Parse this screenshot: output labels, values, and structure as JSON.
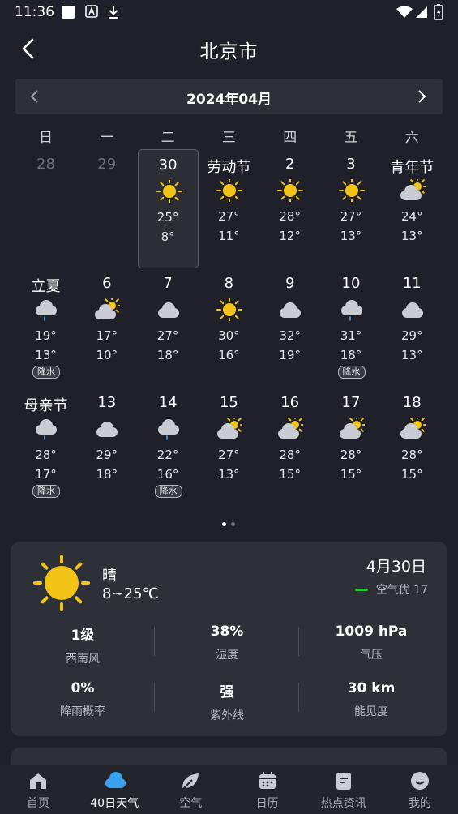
{
  "status": {
    "time": "11:36"
  },
  "header": {
    "city": "北京市"
  },
  "calendar": {
    "month": "2024年04月",
    "weekdays": [
      "日",
      "一",
      "二",
      "三",
      "四",
      "五",
      "六"
    ],
    "days": [
      {
        "label": "28",
        "dim": true
      },
      {
        "label": "29",
        "dim": true
      },
      {
        "label": "30",
        "icon": "sun-icon",
        "high": "25°",
        "low": "8°",
        "selected": true
      },
      {
        "label": "劳动节",
        "icon": "sun-icon",
        "high": "27°",
        "low": "11°"
      },
      {
        "label": "2",
        "icon": "sun-icon",
        "high": "28°",
        "low": "12°"
      },
      {
        "label": "3",
        "icon": "sun-icon",
        "high": "27°",
        "low": "13°"
      },
      {
        "label": "青年节",
        "icon": "partly-cloudy-icon",
        "high": "24°",
        "low": "13°"
      },
      {
        "label": "立夏",
        "icon": "rain-cloud-icon",
        "high": "19°",
        "low": "13°",
        "badge": "降水"
      },
      {
        "label": "6",
        "icon": "partly-cloudy-icon",
        "high": "17°",
        "low": "10°"
      },
      {
        "label": "7",
        "icon": "cloud-icon",
        "high": "27°",
        "low": "18°"
      },
      {
        "label": "8",
        "icon": "sun-icon",
        "high": "30°",
        "low": "16°"
      },
      {
        "label": "9",
        "icon": "cloud-icon",
        "high": "32°",
        "low": "19°"
      },
      {
        "label": "10",
        "icon": "rain-cloud-icon",
        "high": "31°",
        "low": "18°",
        "badge": "降水"
      },
      {
        "label": "11",
        "icon": "cloud-icon",
        "high": "29°",
        "low": "13°"
      },
      {
        "label": "母亲节",
        "icon": "rain-cloud-icon",
        "high": "28°",
        "low": "17°",
        "badge": "降水"
      },
      {
        "label": "13",
        "icon": "cloud-icon",
        "high": "29°",
        "low": "18°"
      },
      {
        "label": "14",
        "icon": "rain-cloud-icon",
        "high": "22°",
        "low": "16°",
        "badge": "降水"
      },
      {
        "label": "15",
        "icon": "partly-cloudy-icon",
        "high": "27°",
        "low": "13°"
      },
      {
        "label": "16",
        "icon": "partly-cloudy-icon",
        "high": "28°",
        "low": "15°"
      },
      {
        "label": "17",
        "icon": "partly-cloudy-icon",
        "high": "28°",
        "low": "15°"
      },
      {
        "label": "18",
        "icon": "partly-cloudy-icon",
        "high": "28°",
        "low": "15°"
      }
    ]
  },
  "detail": {
    "condition": "晴",
    "temp_range": "8~25℃",
    "date": "4月30日",
    "aqi": "空气优 17",
    "metrics": [
      {
        "value": "1级",
        "label": "西南风"
      },
      {
        "value": "38%",
        "label": "湿度"
      },
      {
        "value": "1009 hPa",
        "label": "气压"
      },
      {
        "value": "0%",
        "label": "降雨概率"
      },
      {
        "value": "强",
        "label": "紫外线"
      },
      {
        "value": "30 km",
        "label": "能见度"
      }
    ]
  },
  "nav": {
    "active": 1,
    "items": [
      {
        "label": "首页",
        "icon": "home-icon"
      },
      {
        "label": "40日天气",
        "icon": "cloud-icon"
      },
      {
        "label": "空气",
        "icon": "leaf-icon"
      },
      {
        "label": "日历",
        "icon": "calendar-icon"
      },
      {
        "label": "热点资讯",
        "icon": "news-icon"
      },
      {
        "label": "我的",
        "icon": "profile-icon"
      }
    ]
  },
  "colors": {
    "background": "#1f2029",
    "card": "#2e3038",
    "sun": "#f2c418",
    "aqi_good": "#2fbf3a"
  }
}
